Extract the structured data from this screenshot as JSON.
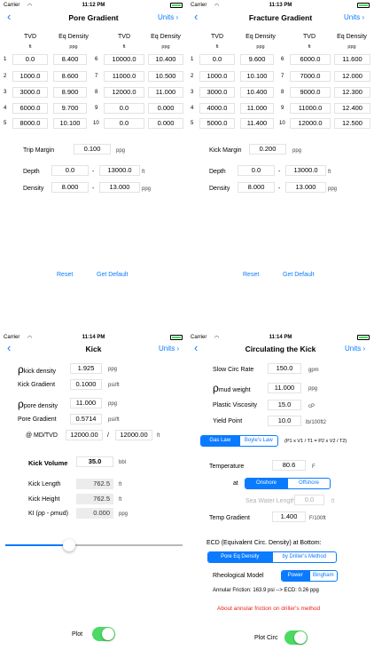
{
  "status": {
    "carrier": "Carrier",
    "time_p1": "11:12 PM",
    "time_p2": "11:13 PM",
    "time_p3": "11:14 PM",
    "time_p4": "11:14 PM"
  },
  "nav": {
    "back": "‹",
    "units": "Units ›"
  },
  "pore": {
    "title": "Pore Gradient",
    "headers": {
      "tvd": "TVD",
      "eqd": "Eq Density",
      "tvd_unit": "ft",
      "eqd_unit": "ppg"
    },
    "rows": [
      {
        "n": "1",
        "tvd": "0.0",
        "eqd": "8.400"
      },
      {
        "n": "2",
        "tvd": "1000.0",
        "eqd": "8.600"
      },
      {
        "n": "3",
        "tvd": "3000.0",
        "eqd": "8.900"
      },
      {
        "n": "4",
        "tvd": "6000.0",
        "eqd": "9.700"
      },
      {
        "n": "5",
        "tvd": "8000.0",
        "eqd": "10.100"
      },
      {
        "n": "6",
        "tvd": "10000.0",
        "eqd": "10.400"
      },
      {
        "n": "7",
        "tvd": "11000.0",
        "eqd": "10.500"
      },
      {
        "n": "8",
        "tvd": "12000.0",
        "eqd": "11.000"
      },
      {
        "n": "9",
        "tvd": "0.0",
        "eqd": "0.000"
      },
      {
        "n": "10",
        "tvd": "0.0",
        "eqd": "0.000"
      }
    ],
    "margin_label": "Trip Margin",
    "margin_value": "0.100",
    "margin_unit": "ppg",
    "depth_label": "Depth",
    "depth_from": "0.0",
    "depth_to": "13000.0",
    "depth_unit": "ft",
    "density_label": "Density",
    "density_from": "8.000",
    "density_to": "13.000",
    "density_unit": "ppg",
    "dash": "-",
    "reset": "Reset",
    "get_default": "Get Default"
  },
  "fracture": {
    "title": "Fracture Gradient",
    "rows": [
      {
        "n": "1",
        "tvd": "0.0",
        "eqd": "9.600"
      },
      {
        "n": "2",
        "tvd": "1000.0",
        "eqd": "10.100"
      },
      {
        "n": "3",
        "tvd": "3000.0",
        "eqd": "10.400"
      },
      {
        "n": "4",
        "tvd": "4000.0",
        "eqd": "11.000"
      },
      {
        "n": "5",
        "tvd": "5000.0",
        "eqd": "11.400"
      },
      {
        "n": "6",
        "tvd": "6000.0",
        "eqd": "11.600"
      },
      {
        "n": "7",
        "tvd": "7000.0",
        "eqd": "12.000"
      },
      {
        "n": "8",
        "tvd": "9000.0",
        "eqd": "12.300"
      },
      {
        "n": "9",
        "tvd": "11000.0",
        "eqd": "12.400"
      },
      {
        "n": "10",
        "tvd": "12000.0",
        "eqd": "12.500"
      }
    ],
    "margin_label": "Kick Margin",
    "margin_value": "0.200",
    "margin_unit": "ppg",
    "depth_from": "0.0",
    "depth_to": "13000.0",
    "density_from": "8.000",
    "density_to": "13.000"
  },
  "kick": {
    "title": "Kick",
    "rho_symbol": "ρ",
    "kick_density_sub": "kick density",
    "kick_density_value": "1.925",
    "kick_density_unit": "ppg",
    "kick_gradient_label": "Kick Gradient",
    "kick_gradient_value": "0.1000",
    "kick_gradient_unit": "psi/ft",
    "pore_density_sub": "pore density",
    "pore_density_value": "11.000",
    "pore_density_unit": "ppg",
    "pore_gradient_label": "Pore Gradient",
    "pore_gradient_value": "0.5714",
    "pore_gradient_unit": "psi/ft",
    "md_tvd_label": "@ MD/TVD",
    "md_value": "12000.00",
    "slash": "/",
    "tvd_value": "12000.00",
    "md_unit": "ft",
    "kick_volume_label": "Kick Volume",
    "kick_volume_value": "35.0",
    "kick_volume_unit": "bbl",
    "kick_length_label": "Kick Length",
    "kick_length_value": "762.5",
    "kick_length_unit": "ft",
    "kick_height_label": "Kick Height",
    "kick_height_value": "762.5",
    "kick_height_unit": "ft",
    "ki_label": "KI (ρp - ρmud)",
    "ki_value": "0.000",
    "ki_unit": "ppg",
    "slider_level": 0.36,
    "plot_label": "Plot",
    "plot_on": true
  },
  "circ": {
    "title": "Circulating the Kick",
    "slow_circ_label": "Slow Circ Rate",
    "slow_circ_value": "150.0",
    "slow_circ_unit": "gpm",
    "mud_weight_sub": "mud weight",
    "mud_weight_value": "11.000",
    "mud_weight_unit": "ppg",
    "pv_label": "Plastic Viscosity",
    "pv_value": "15.0",
    "pv_unit": "cP",
    "yp_label": "Yield Point",
    "yp_value": "10.0",
    "yp_unit": "lb/100ft2",
    "gas_law": "Gas Law",
    "boyles_law": "Boyle's Law",
    "formula": "(P1 x V1 / T1 = P2 x V2 / T2)",
    "temp_label": "Temperature",
    "temp_value": "80.6",
    "temp_unit": "F",
    "at_label": "at",
    "onshore": "Onshore",
    "offshore": "Offshore",
    "sea_water_label": "Sea Water Length",
    "sea_water_value": "0.0",
    "sea_water_unit": "ft",
    "temp_grad_label": "Temp Gradient",
    "temp_grad_value": "1.400",
    "temp_grad_unit": "F/100ft",
    "ecd_label": "ECD (Equivalent Circ. Density) at Bottom:",
    "pore_eq": "Pore Eq Density",
    "by_driller": "by Driller's Method",
    "rheo_label": "Rheological Model",
    "power": "Power",
    "bingham": "Bingham",
    "annular": "Annular Friction: 163.9 psi    --> ECD: 0.26 ppg",
    "about_link": "About annular friction on driller's method",
    "plot_circ_label": "Plot Circ",
    "plot_circ_on": true
  },
  "colors": {
    "accent": "#0a7aff",
    "toggle_on": "#4cd964",
    "warning_link": "#e8231d"
  }
}
